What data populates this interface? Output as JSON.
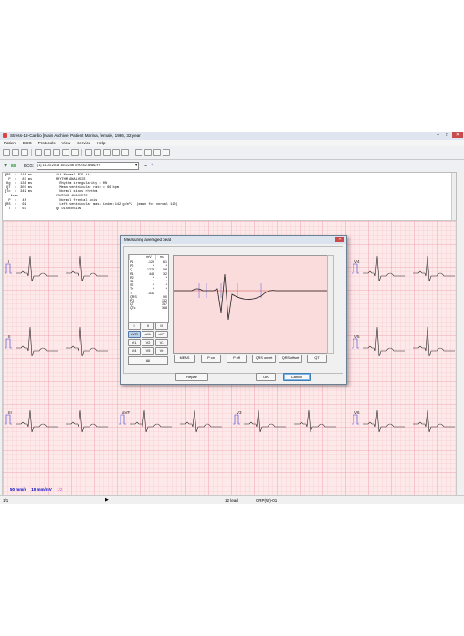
{
  "window": {
    "title": "Stress-12-Cardio [Main Archive] Patient Marina, female, 1986, 32 year"
  },
  "menu": [
    "Patient",
    "ECG",
    "Protocols",
    "View",
    "Service",
    "Help"
  ],
  "ecg_bar": {
    "label": "ECG:",
    "selected": "[1] 11.03.2018 16:22:46 0:00:42 ANALYS"
  },
  "report": {
    "left": [
      "QRS  :  110 ms",
      "  P  :   87 ms",
      " Kg  :  138 ms",
      " QT  :  307 ms",
      "QTc  :  349 ms",
      "-- Axes --",
      "  P  :   45",
      "QRS  :   69",
      "  T  :   67"
    ],
    "right": [
      "*** Normal ECG ***",
      "RHYTHM ANALYSIS",
      "  Rhythm irregularity = 0%",
      "  Mean ventricular rate = 66 bpm",
      "  Normal sinus rhythm",
      "CONTOUR ANALYSIS",
      "  Normal frontal axis",
      "  Left ventricular mass index:142 g/m^2  (mean for normal 110)",
      "QT DISPERSION"
    ]
  },
  "leads": {
    "l1": "I",
    "l2": "II",
    "l3": "III",
    "avf": "aVF",
    "v3": "V3",
    "v4": "V4",
    "v5": "V5",
    "v6": "V6"
  },
  "speed": {
    "speed": "50 mm/s",
    "gain": "10 mm/mV",
    "ver": "1/2"
  },
  "statusbar": {
    "page": "1/1",
    "leads": "12 lead",
    "code": "CRP(W)-01"
  },
  "dialog": {
    "title": "Measuring averaged beat",
    "table": {
      "headers": [
        "",
        "mV",
        "ms"
      ],
      "rows": [
        [
          "P1",
          "-129",
          "61"
        ],
        [
          "P2",
          "*",
          "*"
        ],
        [
          "Q",
          "-1278",
          "58"
        ],
        [
          "R1",
          "448",
          "32"
        ],
        [
          "R2",
          "*",
          "*"
        ],
        [
          "S1",
          "*",
          "*"
        ],
        [
          "S2",
          "*",
          "*"
        ],
        [
          "T+",
          "*",
          "*"
        ],
        [
          "T-",
          "-431",
          ""
        ],
        [
          "QRS",
          "",
          "90"
        ],
        [
          "PQ",
          "",
          "132"
        ],
        [
          "QT",
          "",
          "357"
        ],
        [
          "QTc",
          "",
          "368"
        ]
      ]
    },
    "lead_buttons": [
      "I",
      "II",
      "III",
      "aVR",
      "aVL",
      "aVF",
      "V1",
      "V2",
      "V3",
      "V4",
      "V5",
      "V6"
    ],
    "all_label": "All",
    "measure_buttons": [
      "MEAS",
      "P on",
      "P off",
      "QRS onset",
      "QRS offset",
      "QT"
    ],
    "repair_label": "Repair",
    "ok_label": "OK",
    "cancel_label": "Cancel"
  }
}
